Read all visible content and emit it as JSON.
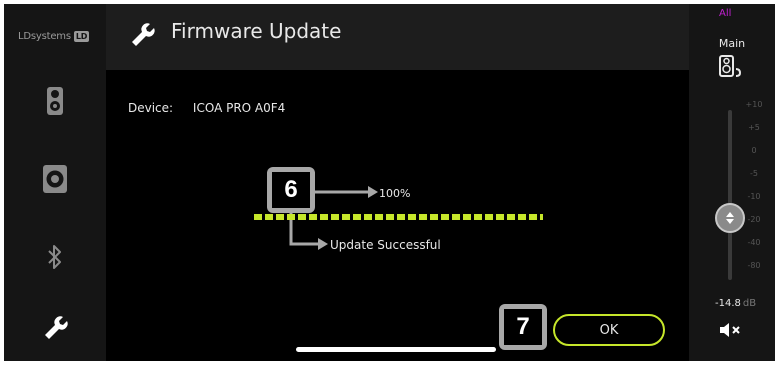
{
  "brand": {
    "name": "LDsystems",
    "badge": "LD"
  },
  "header": {
    "title": "Firmware Update"
  },
  "device": {
    "label": "Device:",
    "name": "ICOA PRO A0F4"
  },
  "progress": {
    "percent_text": "100%",
    "value": 1.0,
    "status": "Update Successful"
  },
  "actions": {
    "ok_label": "OK"
  },
  "callouts": {
    "progress": "6",
    "ok": "7"
  },
  "mixer": {
    "group": "All",
    "channel": "Main",
    "scale": [
      "+10",
      "+5",
      "0",
      "-5",
      "-10",
      "-20",
      "-40",
      "-80"
    ],
    "level": "-14.8",
    "unit": "dB"
  },
  "icons": {
    "sidebar": [
      "speaker-column-icon",
      "speaker-sub-icon",
      "bluetooth-icon",
      "wrench-icon"
    ],
    "header": "wrench-icon",
    "mixer": [
      "speaker-link-icon",
      "fader-updown-icon",
      "mute-icon"
    ]
  },
  "colors": {
    "accent": "#c6e62a",
    "group": "#c020d0",
    "background": "#000000"
  }
}
